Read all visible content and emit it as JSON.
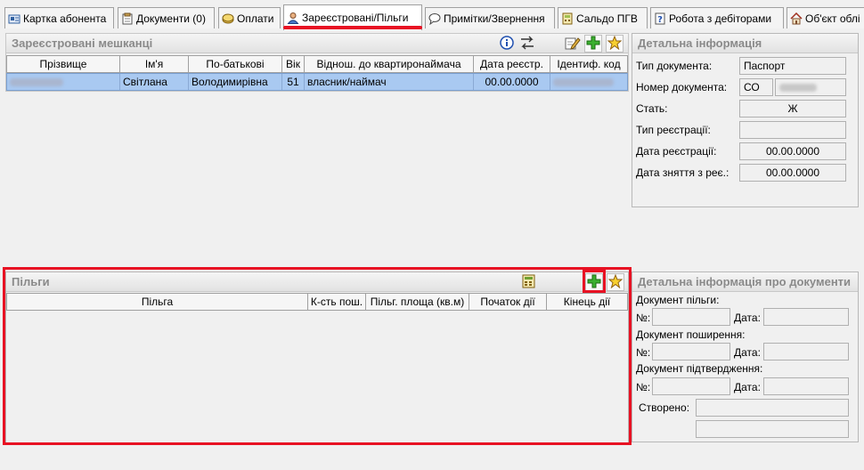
{
  "tabs": [
    {
      "label": "Картка абонента"
    },
    {
      "label": "Документи (0)"
    },
    {
      "label": "Оплати"
    },
    {
      "label": "Зареєстровані/Пільги"
    },
    {
      "label": "Примітки/Звернення"
    },
    {
      "label": "Сальдо ПГВ"
    },
    {
      "label": "Робота з дебіторами"
    },
    {
      "label": "Об'єкт облі"
    }
  ],
  "residents": {
    "title": "Зареєстровані мешканці",
    "columns": [
      "Прізвище",
      "Ім'я",
      "По-батькові",
      "Вік",
      "Віднош. до квартиронаймача",
      "Дата реєстр.",
      "Ідентиф. код"
    ],
    "rows": [
      {
        "name": "Світлана",
        "patronymic": "Володимирівна",
        "age": "51",
        "relation": "власник/наймач",
        "reg_date": "00.00.0000"
      }
    ]
  },
  "details": {
    "title": "Детальна інформація",
    "doc_type_label": "Тип документа:",
    "doc_type_value": "Паспорт",
    "doc_number_label": "Номер документа:",
    "doc_series": "СО",
    "sex_label": "Стать:",
    "sex_value": "Ж",
    "reg_type_label": "Тип реєстрації:",
    "reg_date_label": "Дата реєстрації:",
    "reg_date_value": "00.00.0000",
    "dereg_date_label": "Дата зняття з реє.:",
    "dereg_date_value": "00.00.0000"
  },
  "benefits": {
    "title": "Пільги",
    "columns": [
      "Пільга",
      "К-сть пош.",
      "Пільг. площа (кв.м)",
      "Початок дії",
      "Кінець дії"
    ]
  },
  "doc_details": {
    "title": "Детальна інформація про документи",
    "benefit_doc_label": "Документ пільги:",
    "spread_doc_label": "Документ поширення:",
    "confirm_doc_label": "Документ підтвердження:",
    "number_label": "№:",
    "date_label": "Дата:",
    "created_label": "Створено:"
  }
}
